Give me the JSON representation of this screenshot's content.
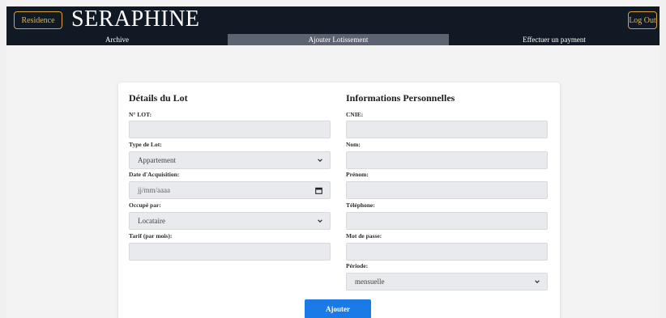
{
  "header": {
    "residence_label": "Residence",
    "brand": "SERAPHINE",
    "logout_label": "Log Out"
  },
  "tabs": [
    {
      "label": "Archive",
      "active": false
    },
    {
      "label": "Ajouter Lotissement",
      "active": true
    },
    {
      "label": "Effectuer un payment",
      "active": false
    }
  ],
  "form": {
    "lot": {
      "title": "Détails du Lot",
      "numero_label": "N° LOT:",
      "numero_value": "",
      "type_label": "Type de Lot:",
      "type_value": "Appartement",
      "date_label": "Date d'Acquisition:",
      "date_placeholder": "jj/mm/aaaa",
      "occupe_label": "Occupé par:",
      "occupe_value": "Locataire",
      "tarif_label": "Tarif (par mois):",
      "tarif_value": ""
    },
    "perso": {
      "title": "Informations Personnelles",
      "cnie_label": "CNIE:",
      "nom_label": "Nom:",
      "prenom_label": "Prénom:",
      "telephone_label": "Téléphone:",
      "password_label": "Mot de passe:",
      "periode_label": "Période:",
      "periode_value": "mensuelle"
    },
    "submit_label": "Ajouter"
  },
  "colors": {
    "navbar": "#111a24",
    "accent_gold": "#d4a23a",
    "active_tab": "#5d6370",
    "submit": "#1a7be8"
  },
  "icons": {
    "select_chevron": "chevron-down-icon",
    "date_picker": "calendar-icon"
  }
}
